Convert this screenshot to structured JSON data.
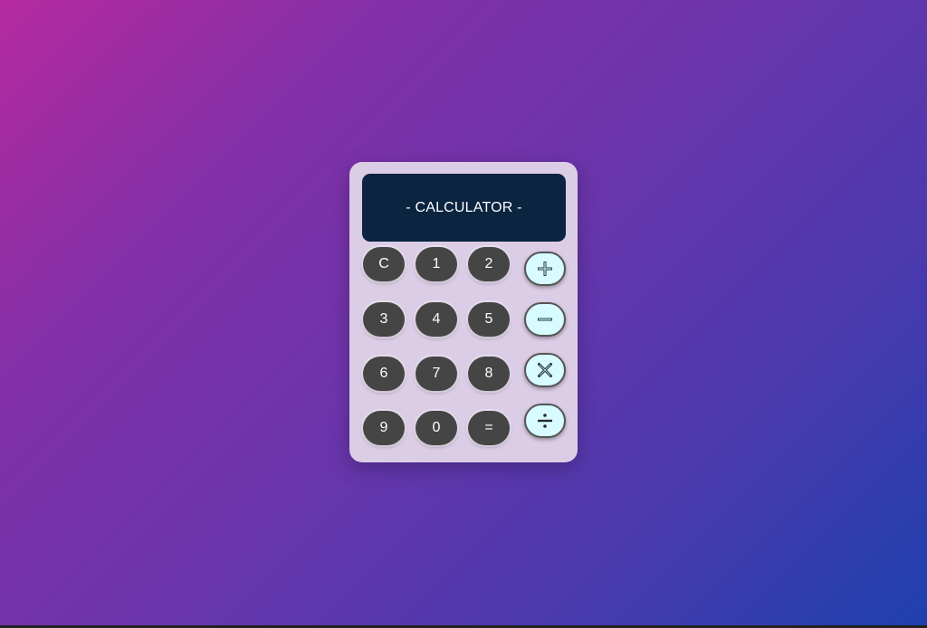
{
  "display": {
    "text": "- CALCULATOR -"
  },
  "keys": {
    "clear": "C",
    "one": "1",
    "two": "2",
    "three": "3",
    "four": "4",
    "five": "5",
    "six": "6",
    "seven": "7",
    "eight": "8",
    "nine": "9",
    "zero": "0",
    "equals": "="
  },
  "operators": [
    {
      "icon": "plus-icon"
    },
    {
      "icon": "minus-icon"
    },
    {
      "icon": "multiply-icon"
    },
    {
      "icon": "divide-icon"
    }
  ],
  "colors": {
    "panel": "#dccde6",
    "display_bg": "#0b2440",
    "key_bg": "#454545",
    "operator_bg": "#d7fbff"
  }
}
